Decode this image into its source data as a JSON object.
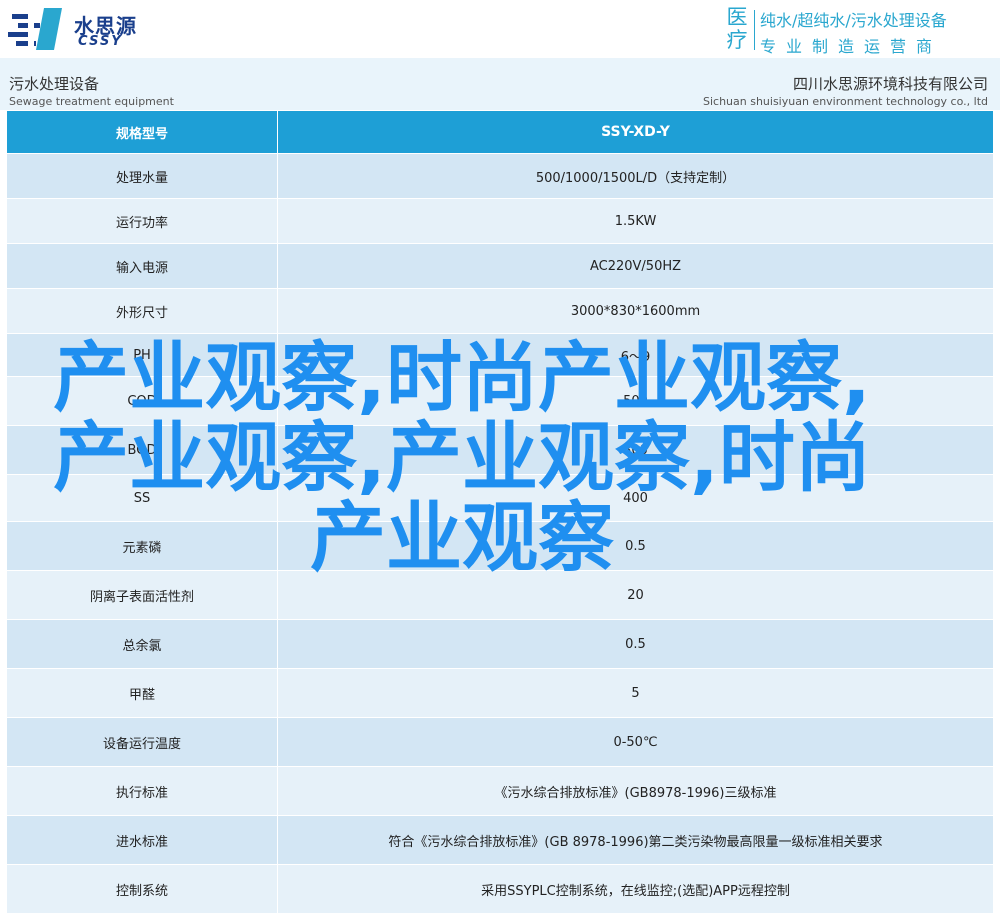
{
  "header": {
    "logo_cn": "水思源",
    "logo_en": "CSSY",
    "slogan_big": "医疗",
    "slogan_line1": "纯水/超纯水/污水处理设备",
    "slogan_line2": "专业制造运营商"
  },
  "subheader": {
    "left_cn": "污水处理设备",
    "left_en": "Sewage treatment equipment",
    "right_cn": "四川水思源环境科技有限公司",
    "right_en": "Sichuan shuisiyuan environment technology co., ltd"
  },
  "table": {
    "header": {
      "label": "规格型号",
      "value": "SSY-XD-Y"
    },
    "rows": [
      {
        "label": "处理水量",
        "value": "500/1000/1500L/D（支持定制）"
      },
      {
        "label": "运行功率",
        "value": "1.5KW"
      },
      {
        "label": "输入电源",
        "value": "AC220V/50HZ"
      },
      {
        "label": "外形尺寸",
        "value": "3000*830*1600mm"
      },
      {
        "label": "PH",
        "value": "6～9"
      },
      {
        "label": "COD",
        "value": "500"
      },
      {
        "label": "BOD",
        "value": "300"
      },
      {
        "label": "SS",
        "value": "400"
      },
      {
        "label": "元素磷",
        "value": "0.5"
      },
      {
        "label": "阴离子表面活性剂",
        "value": "20"
      },
      {
        "label": "总余氯",
        "value": "0.5"
      },
      {
        "label": "甲醛",
        "value": "5"
      },
      {
        "label": "设备运行温度",
        "value": "0-50℃"
      },
      {
        "label": "执行标准",
        "value": "《污水综合排放标准》(GB8978-1996)三级标准"
      },
      {
        "label": "进水标准",
        "value": "符合《污水综合排放标准》(GB 8978-1996)第二类污染物最高限量一级标准相关要求"
      },
      {
        "label": "控制系统",
        "value": "采用SSYPLC控制系统，在线监控;(选配)APP远程控制"
      }
    ]
  },
  "watermark": {
    "text": "产业观察,时尚产业观察,产业观察,产业观察,时尚产业观察"
  },
  "colors": {
    "accent": "#1e9fd6",
    "row_dark": "#d3e6f4",
    "row_light": "#e6f1f9",
    "watermark": "#1f8ff0"
  }
}
